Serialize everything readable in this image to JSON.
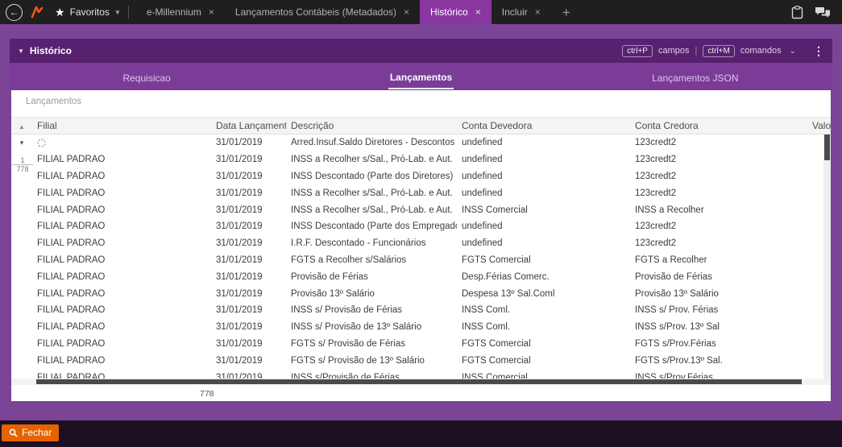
{
  "colors": {
    "topbar_bg": "#1f1f1f",
    "accent_purple": "#8a36a1",
    "page_purple": "#7c4496",
    "strip_purple": "#58216f",
    "tabrow_purple": "#7b3c98",
    "footer_bg": "#1d1022",
    "fechar_orange": "#e56300",
    "scroll_thumb": "#4a4a4a"
  },
  "icons": {
    "back_arrow": "←",
    "star": "★",
    "chevron_down": "⌄",
    "caret_down": "▼",
    "row_caret": "▾",
    "sort_asc": "▲",
    "kebab": "⋮",
    "plus": "+",
    "close": "×"
  },
  "topbar": {
    "favorites_label": "Favoritos",
    "tabs": [
      {
        "label": "e-Millennium",
        "active": false
      },
      {
        "label": "Lançamentos Contábeis (Metadados)",
        "active": false
      },
      {
        "label": "Histórico",
        "active": true
      },
      {
        "label": "Incluir",
        "active": false
      }
    ]
  },
  "panel": {
    "title": "Histórico",
    "shortcuts": {
      "campos_key": "ctrl+P",
      "campos_label": "campos",
      "separator": "|",
      "comandos_key": "ctrl+M",
      "comandos_label": "comandos"
    },
    "tabs": [
      {
        "label": "Requisicao",
        "active": false
      },
      {
        "label": "Lançamentos",
        "active": true
      },
      {
        "label": "Lançamentos JSON",
        "active": false
      }
    ]
  },
  "grid": {
    "section_label": "Lançamentos",
    "columns": [
      "Filial",
      "Data Lançamento",
      "Descrição",
      "Conta Devedora",
      "Conta Credora",
      "Valor"
    ],
    "row_counter": {
      "current": "1",
      "total": "778"
    },
    "total_count": "778",
    "rows": [
      {
        "loading": true,
        "filial": "",
        "data": "31/01/2019",
        "descricao": "Arred.Insuf.Saldo Diretores - Descontos",
        "devedora": "undefined",
        "credora": "123credt2",
        "valor": ""
      },
      {
        "filial": "FILIAL PADRÃO",
        "data": "31/01/2019",
        "descricao": "INSS a Recolher s/Sal., Pró-Lab. e Aut.",
        "devedora": "undefined",
        "credora": "123credt2",
        "valor": ""
      },
      {
        "filial": "FILIAL PADRÃO",
        "data": "31/01/2019",
        "descricao": "INSS Descontado (Parte dos Diretores)",
        "devedora": "undefined",
        "credora": "123credt2",
        "valor": ""
      },
      {
        "filial": "FILIAL PADRÃO",
        "data": "31/01/2019",
        "descricao": "INSS a Recolher s/Sal., Pró-Lab. e Aut.",
        "devedora": "undefined",
        "credora": "123credt2",
        "valor": ""
      },
      {
        "filial": "FILIAL PADRÃO",
        "data": "31/01/2019",
        "descricao": "INSS a Recolher s/Sal., Pró-Lab. e Aut.",
        "devedora": "INSS Comercial",
        "credora": "INSS a Recolher",
        "valor": ""
      },
      {
        "filial": "FILIAL PADRÃO",
        "data": "31/01/2019",
        "descricao": "INSS Descontado (Parte dos Empregados)",
        "devedora": "undefined",
        "credora": "123credt2",
        "valor": ""
      },
      {
        "filial": "FILIAL PADRÃO",
        "data": "31/01/2019",
        "descricao": "I.R.F. Descontado - Funcionários",
        "devedora": "undefined",
        "credora": "123credt2",
        "valor": ""
      },
      {
        "filial": "FILIAL PADRÃO",
        "data": "31/01/2019",
        "descricao": "FGTS a Recolher s/Salários",
        "devedora": "FGTS Comercial",
        "credora": "FGTS a Recolher",
        "valor": ""
      },
      {
        "filial": "FILIAL PADRÃO",
        "data": "31/01/2019",
        "descricao": "Provisão de Férias",
        "devedora": "Desp.Férias Comerc.",
        "credora": "Provisão de Férias",
        "valor": ""
      },
      {
        "filial": "FILIAL PADRÃO",
        "data": "31/01/2019",
        "descricao": "Provisão 13º Salário",
        "devedora": "Despesa 13º Sal.Coml",
        "credora": "Provisão 13º Salário",
        "valor": ""
      },
      {
        "filial": "FILIAL PADRÃO",
        "data": "31/01/2019",
        "descricao": "INSS s/ Provisão de Férias",
        "devedora": "INSS Coml.",
        "credora": "INSS s/ Prov. Férias",
        "valor": ""
      },
      {
        "filial": "FILIAL PADRÃO",
        "data": "31/01/2019",
        "descricao": "INSS s/ Provisão de 13º Salário",
        "devedora": "INSS Coml.",
        "credora": "INSS s/Prov. 13º Sal",
        "valor": ""
      },
      {
        "filial": "FILIAL PADRÃO",
        "data": "31/01/2019",
        "descricao": "FGTS s/ Provisão de Férias",
        "devedora": "FGTS Comercial",
        "credora": "FGTS s/Prov.Férias",
        "valor": ""
      },
      {
        "filial": "FILIAL PADRÃO",
        "data": "31/01/2019",
        "descricao": "FGTS s/ Provisão de 13º Salário",
        "devedora": "FGTS Comercial",
        "credora": "FGTS s/Prov.13º Sal.",
        "valor": ""
      },
      {
        "filial": "FILIAL PADRÃO",
        "data": "31/01/2019",
        "descricao": "INSS s/Provisão de Férias",
        "devedora": "INSS Comercial",
        "credora": "INSS s/Prov.Férias",
        "valor": ""
      }
    ]
  },
  "footer": {
    "fechar_label": "Fechar"
  }
}
